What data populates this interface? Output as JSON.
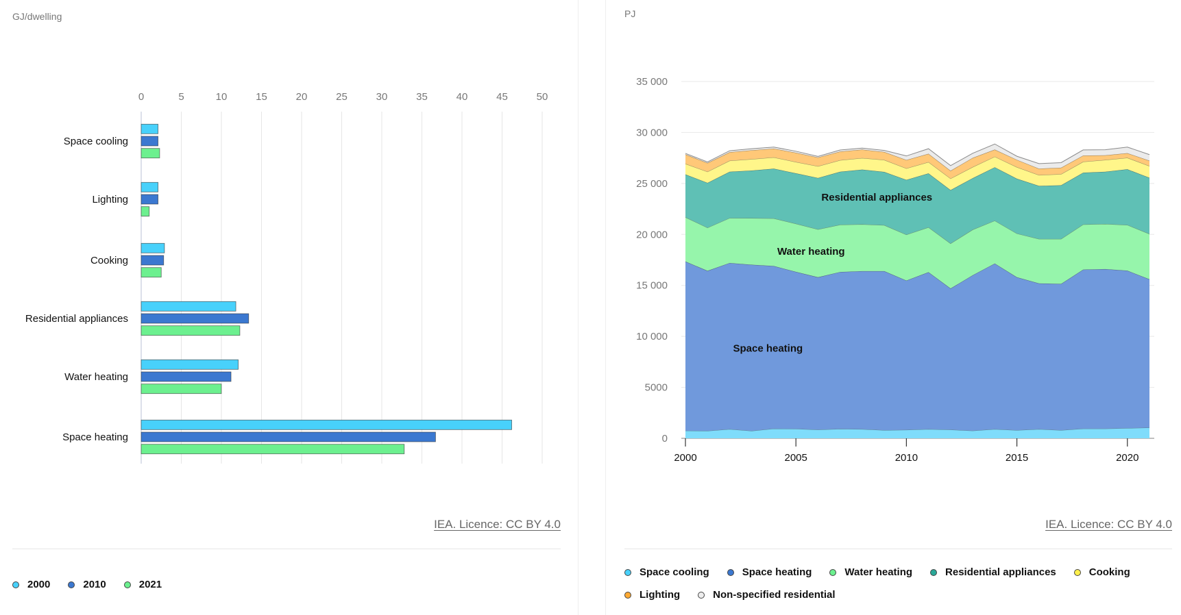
{
  "left": {
    "unit": "GJ/dwelling",
    "licence": "IEA. Licence: CC BY 4.0",
    "legend": [
      {
        "label": "2000",
        "color": "#48d1fb"
      },
      {
        "label": "2010",
        "color": "#3b78d0"
      },
      {
        "label": "2021",
        "color": "#6cf08f"
      }
    ]
  },
  "right": {
    "unit": "PJ",
    "licence": "IEA. Licence: CC BY 4.0",
    "legend": [
      {
        "label": "Space cooling",
        "color": "#48d1fb"
      },
      {
        "label": "Space heating",
        "color": "#3b78d0"
      },
      {
        "label": "Water heating",
        "color": "#6cf08f"
      },
      {
        "label": "Residential appliances",
        "color": "#2aa898"
      },
      {
        "label": "Cooking",
        "color": "#fff04d"
      },
      {
        "label": "Lighting",
        "color": "#ffaa33"
      },
      {
        "label": "Non-specified residential",
        "color": "#eeeeee"
      }
    ]
  },
  "chart_data": [
    {
      "type": "bar",
      "orientation": "horizontal",
      "xlabel": "GJ/dwelling",
      "xlim": [
        0,
        50
      ],
      "xticks": [
        "0",
        "5",
        "10",
        "15",
        "20",
        "25",
        "30",
        "35",
        "40",
        "45",
        "50"
      ],
      "grid": true,
      "legend_position": "bottom-left",
      "categories": [
        "Space cooling",
        "Lighting",
        "Cooking",
        "Residential appliances",
        "Water heating",
        "Space heating"
      ],
      "series": [
        {
          "name": "2000",
          "color": "#48d1fb",
          "values": [
            2.1,
            2.1,
            2.9,
            11.8,
            12.1,
            46.2
          ]
        },
        {
          "name": "2010",
          "color": "#3b78d0",
          "values": [
            2.1,
            2.1,
            2.8,
            13.4,
            11.2,
            36.7
          ]
        },
        {
          "name": "2021",
          "color": "#6cf08f",
          "values": [
            2.3,
            1.0,
            2.5,
            12.3,
            10.0,
            32.8
          ]
        }
      ]
    },
    {
      "type": "area",
      "stacked": true,
      "ylabel": "PJ",
      "ylim": [
        0,
        35000
      ],
      "yticks": [
        "0",
        "5000",
        "10 000",
        "15 000",
        "20 000",
        "25 000",
        "30 000",
        "35 000"
      ],
      "xlim": [
        2000,
        2021
      ],
      "xticks": [
        "2000",
        "2005",
        "2010",
        "2015",
        "2020"
      ],
      "grid": true,
      "legend_position": "bottom",
      "x": [
        2000,
        2001,
        2002,
        2003,
        2004,
        2005,
        2006,
        2007,
        2008,
        2009,
        2010,
        2011,
        2012,
        2013,
        2014,
        2015,
        2016,
        2017,
        2018,
        2019,
        2020,
        2021
      ],
      "annotations": [
        {
          "text": "Space heating",
          "x": 2002,
          "y": 8500
        },
        {
          "text": "Water heating",
          "x": 2004,
          "y": 18000
        },
        {
          "text": "Residential appliances",
          "x": 2006,
          "y": 23300
        }
      ],
      "series": [
        {
          "name": "Space cooling",
          "color": "#7fdcfb",
          "values": [
            750,
            730,
            900,
            730,
            950,
            930,
            850,
            920,
            900,
            800,
            830,
            900,
            850,
            750,
            900,
            800,
            900,
            800,
            950,
            950,
            1000,
            1050
          ]
        },
        {
          "name": "Space heating",
          "color": "#7099dc",
          "values": [
            16600,
            15700,
            16300,
            16300,
            15950,
            15400,
            14950,
            15400,
            15500,
            15600,
            14650,
            15400,
            13850,
            15250,
            16250,
            15000,
            14300,
            14350,
            15600,
            15650,
            15450,
            14550
          ]
        },
        {
          "name": "Water heating",
          "color": "#96f5ab",
          "values": [
            4340,
            4230,
            4410,
            4570,
            4670,
            4720,
            4700,
            4630,
            4590,
            4510,
            4500,
            4400,
            4410,
            4470,
            4200,
            4290,
            4360,
            4410,
            4430,
            4430,
            4480,
            4450
          ]
        },
        {
          "name": "Residential appliances",
          "color": "#5fc0b5",
          "values": [
            4200,
            4400,
            4540,
            4670,
            4880,
            4950,
            5040,
            5200,
            5370,
            5220,
            5370,
            5290,
            5240,
            5050,
            5240,
            5380,
            5200,
            5260,
            5080,
            5120,
            5460,
            5510
          ]
        },
        {
          "name": "Cooking",
          "color": "#fff68a",
          "values": [
            1040,
            1090,
            1080,
            1110,
            1110,
            1110,
            1150,
            1130,
            1130,
            1180,
            1130,
            1110,
            1130,
            1090,
            1040,
            1130,
            1060,
            1090,
            1070,
            1160,
            1130,
            1150
          ]
        },
        {
          "name": "Lighting",
          "color": "#ffc878",
          "values": [
            920,
            860,
            830,
            880,
            860,
            900,
            860,
            850,
            830,
            780,
            820,
            810,
            770,
            900,
            690,
            720,
            630,
            630,
            610,
            450,
            450,
            520
          ]
        },
        {
          "name": "Non-specified residential",
          "color": "#ebebeb",
          "values": [
            100,
            100,
            150,
            150,
            150,
            150,
            100,
            150,
            150,
            150,
            400,
            500,
            500,
            450,
            550,
            350,
            500,
            500,
            550,
            550,
            600,
            600
          ]
        }
      ]
    }
  ]
}
